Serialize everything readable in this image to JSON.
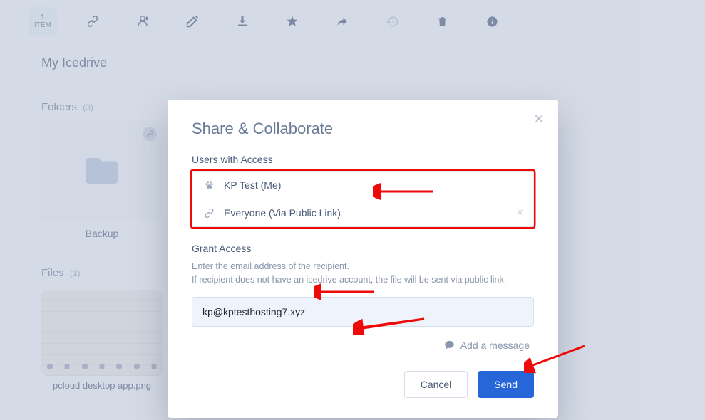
{
  "toolbar": {
    "count": "1",
    "count_label": "ITEM"
  },
  "breadcrumb": "My Icedrive",
  "folders": {
    "label": "Folders",
    "count": "(3)",
    "items": [
      {
        "name": "Backup"
      }
    ]
  },
  "files": {
    "label": "Files",
    "count": "(1)",
    "items": [
      {
        "name": "pcloud desktop app.png"
      }
    ]
  },
  "modal": {
    "title": "Share & Collaborate",
    "users_label": "Users with Access",
    "users": [
      {
        "icon": "paw",
        "label": "KP Test (Me)"
      },
      {
        "icon": "link",
        "label": "Everyone (Via Public Link)"
      }
    ],
    "grant_label": "Grant Access",
    "grant_hint1": "Enter the email address of the recipient.",
    "grant_hint2": "If recipient does not have an icedrive account, the file will be sent via public link.",
    "email_value": "kp@kptesthosting7.xyz",
    "add_message": "Add a message",
    "cancel": "Cancel",
    "send": "Send"
  },
  "colors": {
    "primary": "#2766d8",
    "annotation": "#ef0a0a"
  }
}
